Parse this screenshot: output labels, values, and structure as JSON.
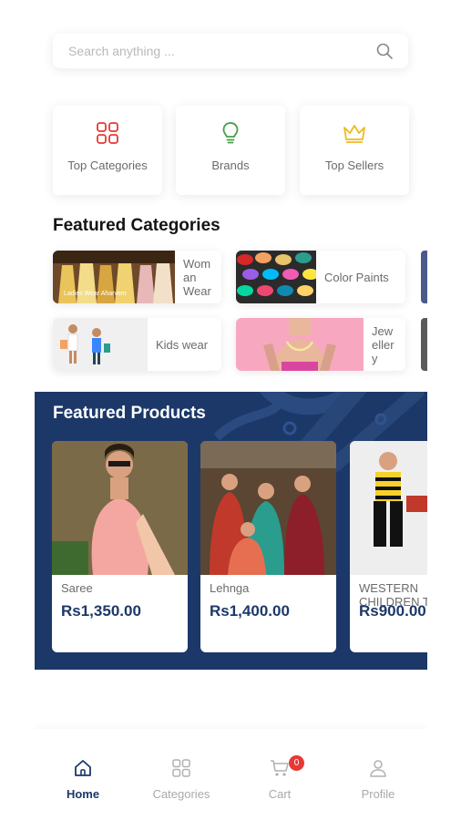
{
  "search": {
    "placeholder": "Search anything ..."
  },
  "quick_links": [
    {
      "label": "Top Categories",
      "icon": "grid-icon",
      "color": "#e53935"
    },
    {
      "label": "Brands",
      "icon": "lightbulb-icon",
      "color": "#43a047"
    },
    {
      "label": "Top Sellers",
      "icon": "crown-icon",
      "color": "#f2b81f"
    }
  ],
  "featured_categories": {
    "title": "Featured Categories",
    "items": [
      {
        "label": "Wom\nan\nWear",
        "image_caption": "Ladies Wear Aharvem"
      },
      {
        "label": "Color Paints"
      },
      {
        "label": "Kids wear"
      },
      {
        "label": "Jew\neller\ny"
      }
    ]
  },
  "featured_products": {
    "title": "Featured Products",
    "items": [
      {
        "name": "Saree",
        "price": "Rs1,350.00"
      },
      {
        "name": "Lehnga",
        "price": "Rs1,400.00"
      },
      {
        "name": "WESTERN\nCHILDREN T",
        "price": "Rs900.00"
      }
    ]
  },
  "bottom_nav": {
    "items": [
      {
        "label": "Home",
        "icon": "home-icon",
        "active": true
      },
      {
        "label": "Categories",
        "icon": "categories-icon",
        "active": false
      },
      {
        "label": "Cart",
        "icon": "cart-icon",
        "active": false,
        "badge": "0"
      },
      {
        "label": "Profile",
        "icon": "profile-icon",
        "active": false
      }
    ]
  },
  "colors": {
    "primary": "#1c3869",
    "badge": "#e53935"
  }
}
